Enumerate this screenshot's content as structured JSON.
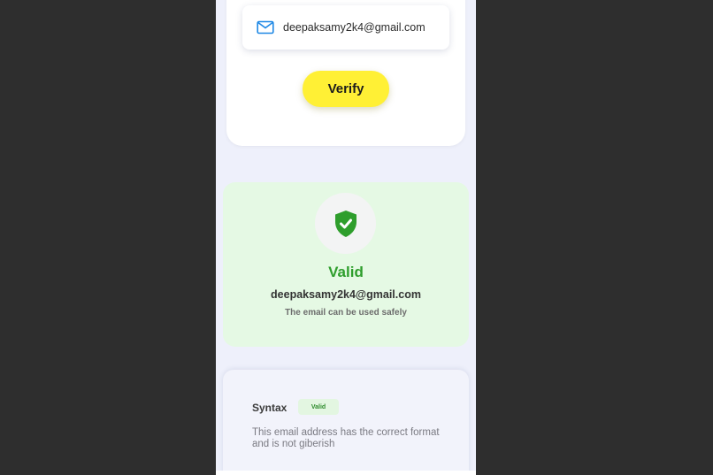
{
  "email_input": {
    "value": "deepaksamy2k4@gmail.com",
    "icon": "mail-icon"
  },
  "verify_button": {
    "label": "Verify"
  },
  "result": {
    "status": "Valid",
    "email": "deepaksamy2k4@gmail.com",
    "message": "The email can be used safely",
    "icon": "shield-check-icon",
    "color": "#2e9e2c"
  },
  "details": {
    "syntax": {
      "label": "Syntax",
      "badge": "Valid",
      "description": "This email address has the correct format and is not giberish"
    }
  },
  "colors": {
    "accent_yellow": "#fff035",
    "success_green": "#2e9e2c",
    "input_icon_blue": "#1e88e5"
  }
}
